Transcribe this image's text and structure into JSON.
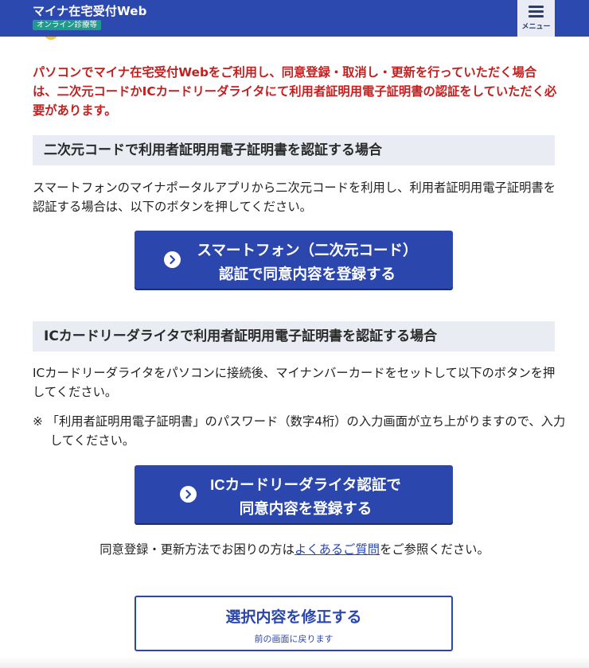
{
  "header": {
    "title": "マイナ在宅受付Web",
    "badge": "オンライン診療等",
    "menu_label": "メニュー"
  },
  "notice": "パソコンでマイナ在宅受付Webをご利用し、同意登録・取消し・更新を行っていただく場合は、二次元コードかICカードリーダライタにて利用者証明用電子証明書の認証をしていただく必要があります。",
  "sections": [
    {
      "heading": "二次元コードで利用者証明用電子証明書を認証する場合",
      "description": "スマートフォンのマイナポータルアプリから二次元コードを利用し、利用者証明用電子証明書を認証する場合は、以下のボタンを押してください。",
      "button_line1": "スマートフォン（二次元コード）",
      "button_line2": "認証で同意内容を登録する"
    },
    {
      "heading": "ICカードリーダライタで利用者証明用電子証明書を認証する場合",
      "description": "ICカードリーダライタをパソコンに接続後、マイナンバーカードをセットして以下のボタンを押してください。",
      "note": "※ 「利用者証明用電子証明書」のパスワード（数字4桁）の入力画面が立ち上がりますので、入力してください。",
      "button_line1": "ICカードリーダライタ認証で",
      "button_line2": "同意内容を登録する"
    }
  ],
  "help": {
    "prefix": "同意登録・更新方法でお困りの方は",
    "link": "よくあるご質問",
    "suffix": "をご参照ください。"
  },
  "edit_button": {
    "label": "選択内容を修正する",
    "sub": "前の画面に戻ります"
  },
  "colors": {
    "brand": "#2c49b0",
    "button": "#2b47ad",
    "notice": "#c41f1f",
    "section_bg": "#e9ecf2",
    "badge": "#1f9a8c"
  },
  "icons": {
    "menu": "hamburger-icon",
    "button_arrow": "chevron-right-circle-icon"
  }
}
